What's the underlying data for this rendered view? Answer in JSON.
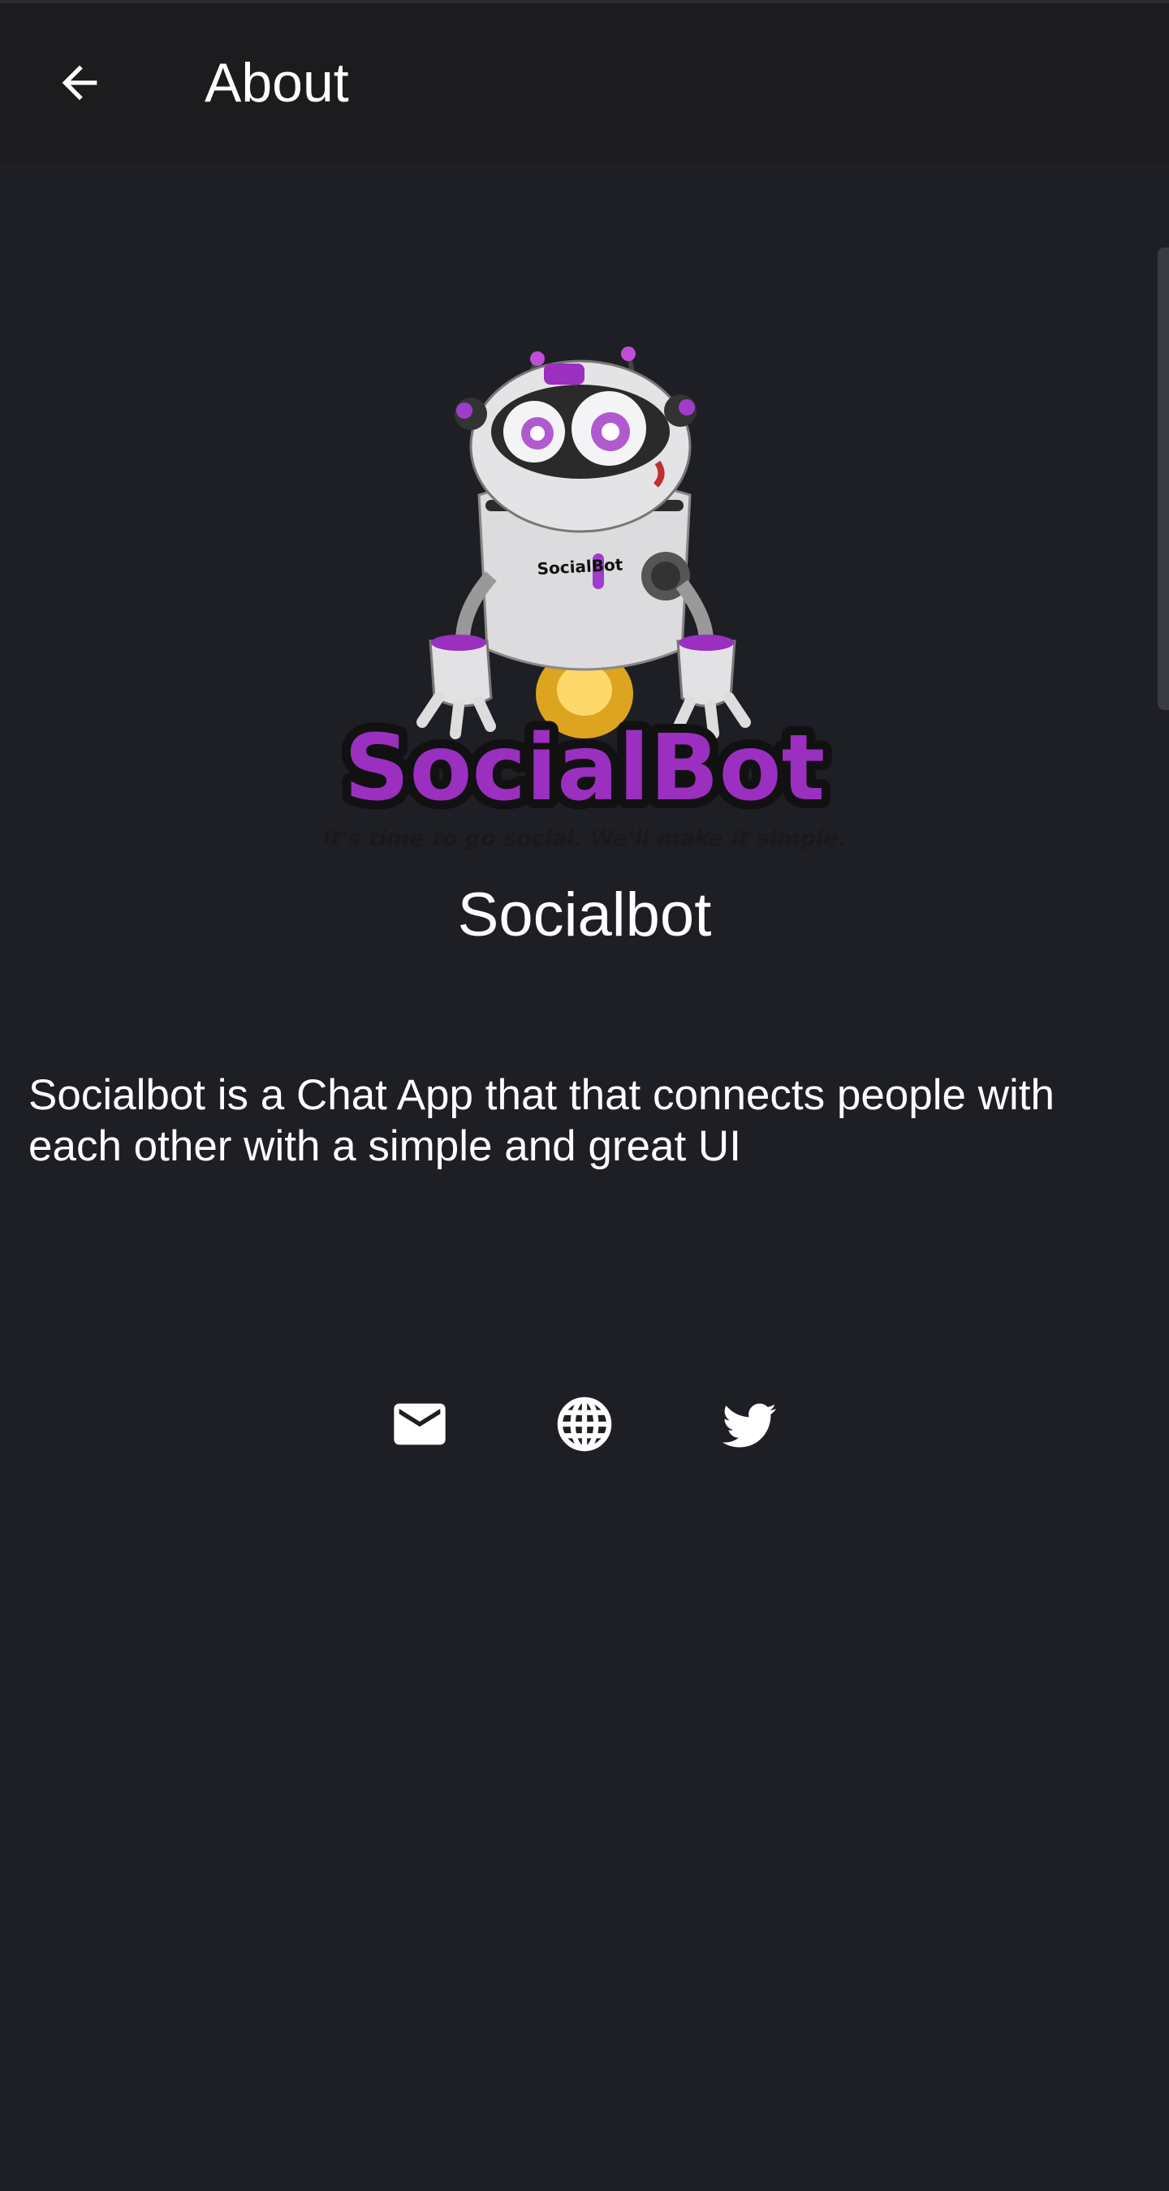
{
  "appbar": {
    "back_icon": "arrow-left-icon",
    "title": "About"
  },
  "logo": {
    "wordmark": "SocialBot",
    "chest_label": "SocialBot",
    "tagline": "It's time to go social. We'll make it simple.",
    "colors": {
      "purple": "#9b2fbf",
      "body": "#e6e6e8",
      "dark": "#2a2a2a"
    }
  },
  "app": {
    "name": "Socialbot",
    "description": "Socialbot is a Chat App that that connects people with each other with a simple and great UI"
  },
  "links": [
    {
      "icon": "email-icon",
      "label": "Email"
    },
    {
      "icon": "globe-icon",
      "label": "Website"
    },
    {
      "icon": "twitter-icon",
      "label": "Twitter"
    }
  ],
  "colors": {
    "background": "#1e1f24",
    "appbar": "#1c1c1e",
    "text": "#ffffff"
  }
}
